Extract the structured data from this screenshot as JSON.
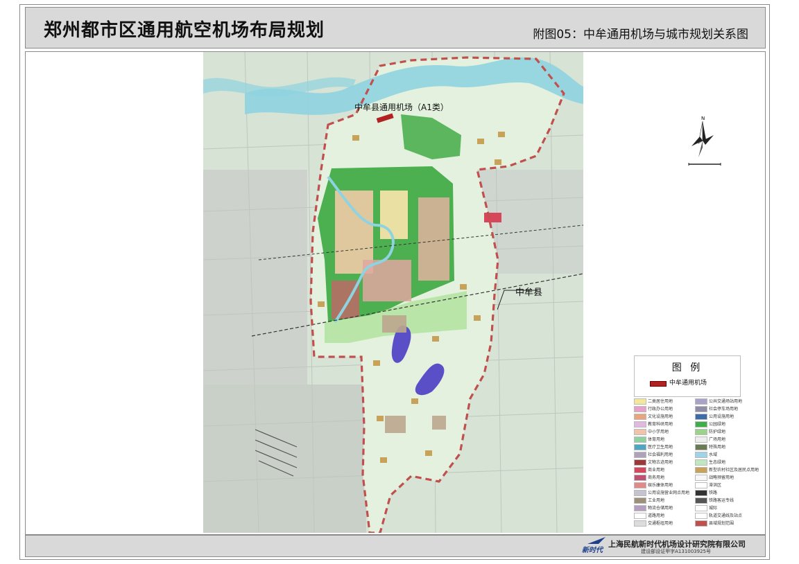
{
  "header": {
    "title": "郑州都市区通用航空机场布局规划",
    "subtitle": "附图05：中牟通用机场与城市规划关系图"
  },
  "map": {
    "airport_label": "中牟县通用机场（A1类）",
    "county_label": "中牟县",
    "colors": {
      "river": "#8fd3e0",
      "boundary": "#c0504d",
      "green": "#4caf50",
      "light_green": "#b9e6a8",
      "airport": "#b22222",
      "lake": "#5b4fc8",
      "base": "#cfe0cf"
    }
  },
  "legend": {
    "title": "图 例",
    "key_label": "中牟通用机场",
    "items": [
      {
        "label": "二类居住用地",
        "color": "#f5e79a"
      },
      {
        "label": "公共交通场站用地",
        "color": "#a9a3c9"
      },
      {
        "label": "行政办公用地",
        "color": "#e7a0c8"
      },
      {
        "label": "社会停车场用地",
        "color": "#8e8ea8"
      },
      {
        "label": "文化设施用地",
        "color": "#e6a57a"
      },
      {
        "label": "公用设施用地",
        "color": "#3d6ca8"
      },
      {
        "label": "教育科研用地",
        "color": "#e0b8e0"
      },
      {
        "label": "公园绿地",
        "color": "#3fae49"
      },
      {
        "label": "中小学用地",
        "color": "#f1c3a8"
      },
      {
        "label": "防护绿地",
        "color": "#9bd38a"
      },
      {
        "label": "体育用地",
        "color": "#8fd1a0"
      },
      {
        "label": "广场用地",
        "color": "#eeeeee"
      },
      {
        "label": "医疗卫生用地",
        "color": "#4fa6c3"
      },
      {
        "label": "特殊用地",
        "color": "#6b7a52"
      },
      {
        "label": "社会福利用地",
        "color": "#b0a3b8"
      },
      {
        "label": "水域",
        "color": "#9fd4e8"
      },
      {
        "label": "文物古迹用地",
        "color": "#9c3a3a"
      },
      {
        "label": "生态绿地",
        "color": "#bfe8bf"
      },
      {
        "label": "商业用地",
        "color": "#d7475b"
      },
      {
        "label": "新型农村社区及居民点用地",
        "color": "#c9a25a"
      },
      {
        "label": "商务用地",
        "color": "#c0506f"
      },
      {
        "label": "战略预留用地",
        "color": "#f7f7f7"
      },
      {
        "label": "娱乐康体用地",
        "color": "#e08a8a"
      },
      {
        "label": "滞洪区",
        "color": "#ffffff"
      },
      {
        "label": "公用设施营业网点用地",
        "color": "#c7c2d0"
      },
      {
        "label": "铁路",
        "color": "#333333"
      },
      {
        "label": "工业用地",
        "color": "#9d8f7a"
      },
      {
        "label": "铁路客运专线",
        "color": "#555555"
      },
      {
        "label": "物流仓储用地",
        "color": "#b59ec0"
      },
      {
        "label": "城际",
        "color": "#ffffff"
      },
      {
        "label": "道路用地",
        "color": "#ffffff"
      },
      {
        "label": "轨道交通线及站点",
        "color": "#ffffff"
      },
      {
        "label": "交通枢纽用地",
        "color": "#dcdcdc"
      },
      {
        "label": "县域规划范围",
        "color": "#c0504d"
      }
    ]
  },
  "footer": {
    "brand": "新时代",
    "institute": "上海民航新时代机场设计研究院有限公司",
    "certificate": "建设部设证甲字A131003925号"
  }
}
